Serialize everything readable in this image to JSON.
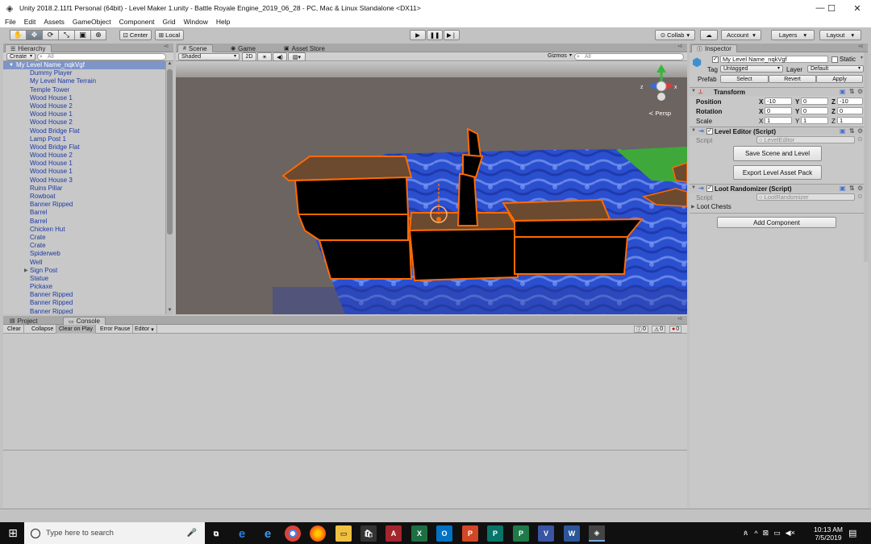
{
  "window": {
    "title": "Unity 2018.2.11f1 Personal (64bit) - Level Maker 1.unity - Battle Royale Engine_2019_06_28 - PC, Mac & Linux Standalone <DX11>"
  },
  "menu": [
    "File",
    "Edit",
    "Assets",
    "GameObject",
    "Component",
    "Grid",
    "Window",
    "Help"
  ],
  "toolbar": {
    "pivot_label": "Center",
    "space_label": "Local",
    "collab_label": "Collab",
    "account_label": "Account",
    "layers_label": "Layers",
    "layout_label": "Layout"
  },
  "hierarchy": {
    "tab_label": "Hierarchy",
    "create_label": "Create",
    "search_placeholder": "All",
    "root": "My Level Name_nqkVgf",
    "items": [
      "Dummy Player",
      "My Level Name Terrain",
      "Temple Tower",
      "Wood House 1",
      "Wood House 2",
      "Wood House 1",
      "Wood House 2",
      "Wood Bridge Flat",
      "Lamp Post 1",
      "Wood Bridge Flat",
      "Wood House 2",
      "Wood House 1",
      "Wood House 1",
      "Wood House 3",
      "Ruins Pillar",
      "Rowboat",
      "Banner Ripped",
      "Barrel",
      "Barrel",
      "Chicken Hut",
      "Crate",
      "Crate",
      "Spiderweb",
      "Well",
      "Sign Post",
      "Statue",
      "Pickaxe",
      "Banner Ripped",
      "Banner Ripped",
      "Banner Ripped"
    ]
  },
  "scene": {
    "tab_scene": "Scene",
    "tab_game": "Game",
    "tab_asset_store": "Asset Store",
    "shading_mode": "Shaded",
    "mode_2d": "2D",
    "gizmos_label": "Gizmos",
    "search_placeholder": "All",
    "persp_label": "Persp",
    "axis_z": "z",
    "axis_x": "x"
  },
  "console": {
    "tab_project": "Project",
    "tab_console": "Console",
    "buttons": [
      "Clear",
      "Collapse",
      "Clear on Play",
      "Error Pause",
      "Editor"
    ],
    "count_log": "0",
    "count_warn": "0",
    "count_error": "0"
  },
  "inspector": {
    "tab_label": "Inspector",
    "object_name": "My Level Name_nqkVgf",
    "static_label": "Static",
    "tag_label": "Tag",
    "tag_value": "Untagged",
    "layer_label": "Layer",
    "layer_value": "Default",
    "prefab_label": "Prefab",
    "prefab_select": "Select",
    "prefab_revert": "Revert",
    "prefab_apply": "Apply",
    "transform": {
      "title": "Transform",
      "position_label": "Position",
      "rotation_label": "Rotation",
      "scale_label": "Scale",
      "position": {
        "x": "-10",
        "y": "0",
        "z": "-10"
      },
      "rotation": {
        "x": "0",
        "y": "0",
        "z": "0"
      },
      "scale": {
        "x": "1",
        "y": "1",
        "z": "1"
      }
    },
    "level_editor": {
      "title": "Level Editor (Script)",
      "script_label": "Script",
      "script_value": "LevelEditor",
      "save_button": "Save Scene and Level",
      "export_button": "Export Level Asset Pack"
    },
    "loot_randomizer": {
      "title": "Loot Randomizer (Script)",
      "script_label": "Script",
      "script_value": "LootRandomizer",
      "loot_chests_label": "Loot Chests"
    },
    "add_component": "Add Component"
  },
  "taskbar": {
    "search_placeholder": "Type here to search",
    "time": "10:13 AM",
    "date": "7/5/2019"
  },
  "colors": {
    "accent_selection": "#7d95c7",
    "hierarchy_text": "#1c3aa4",
    "outline_orange": "#ff6a00"
  }
}
